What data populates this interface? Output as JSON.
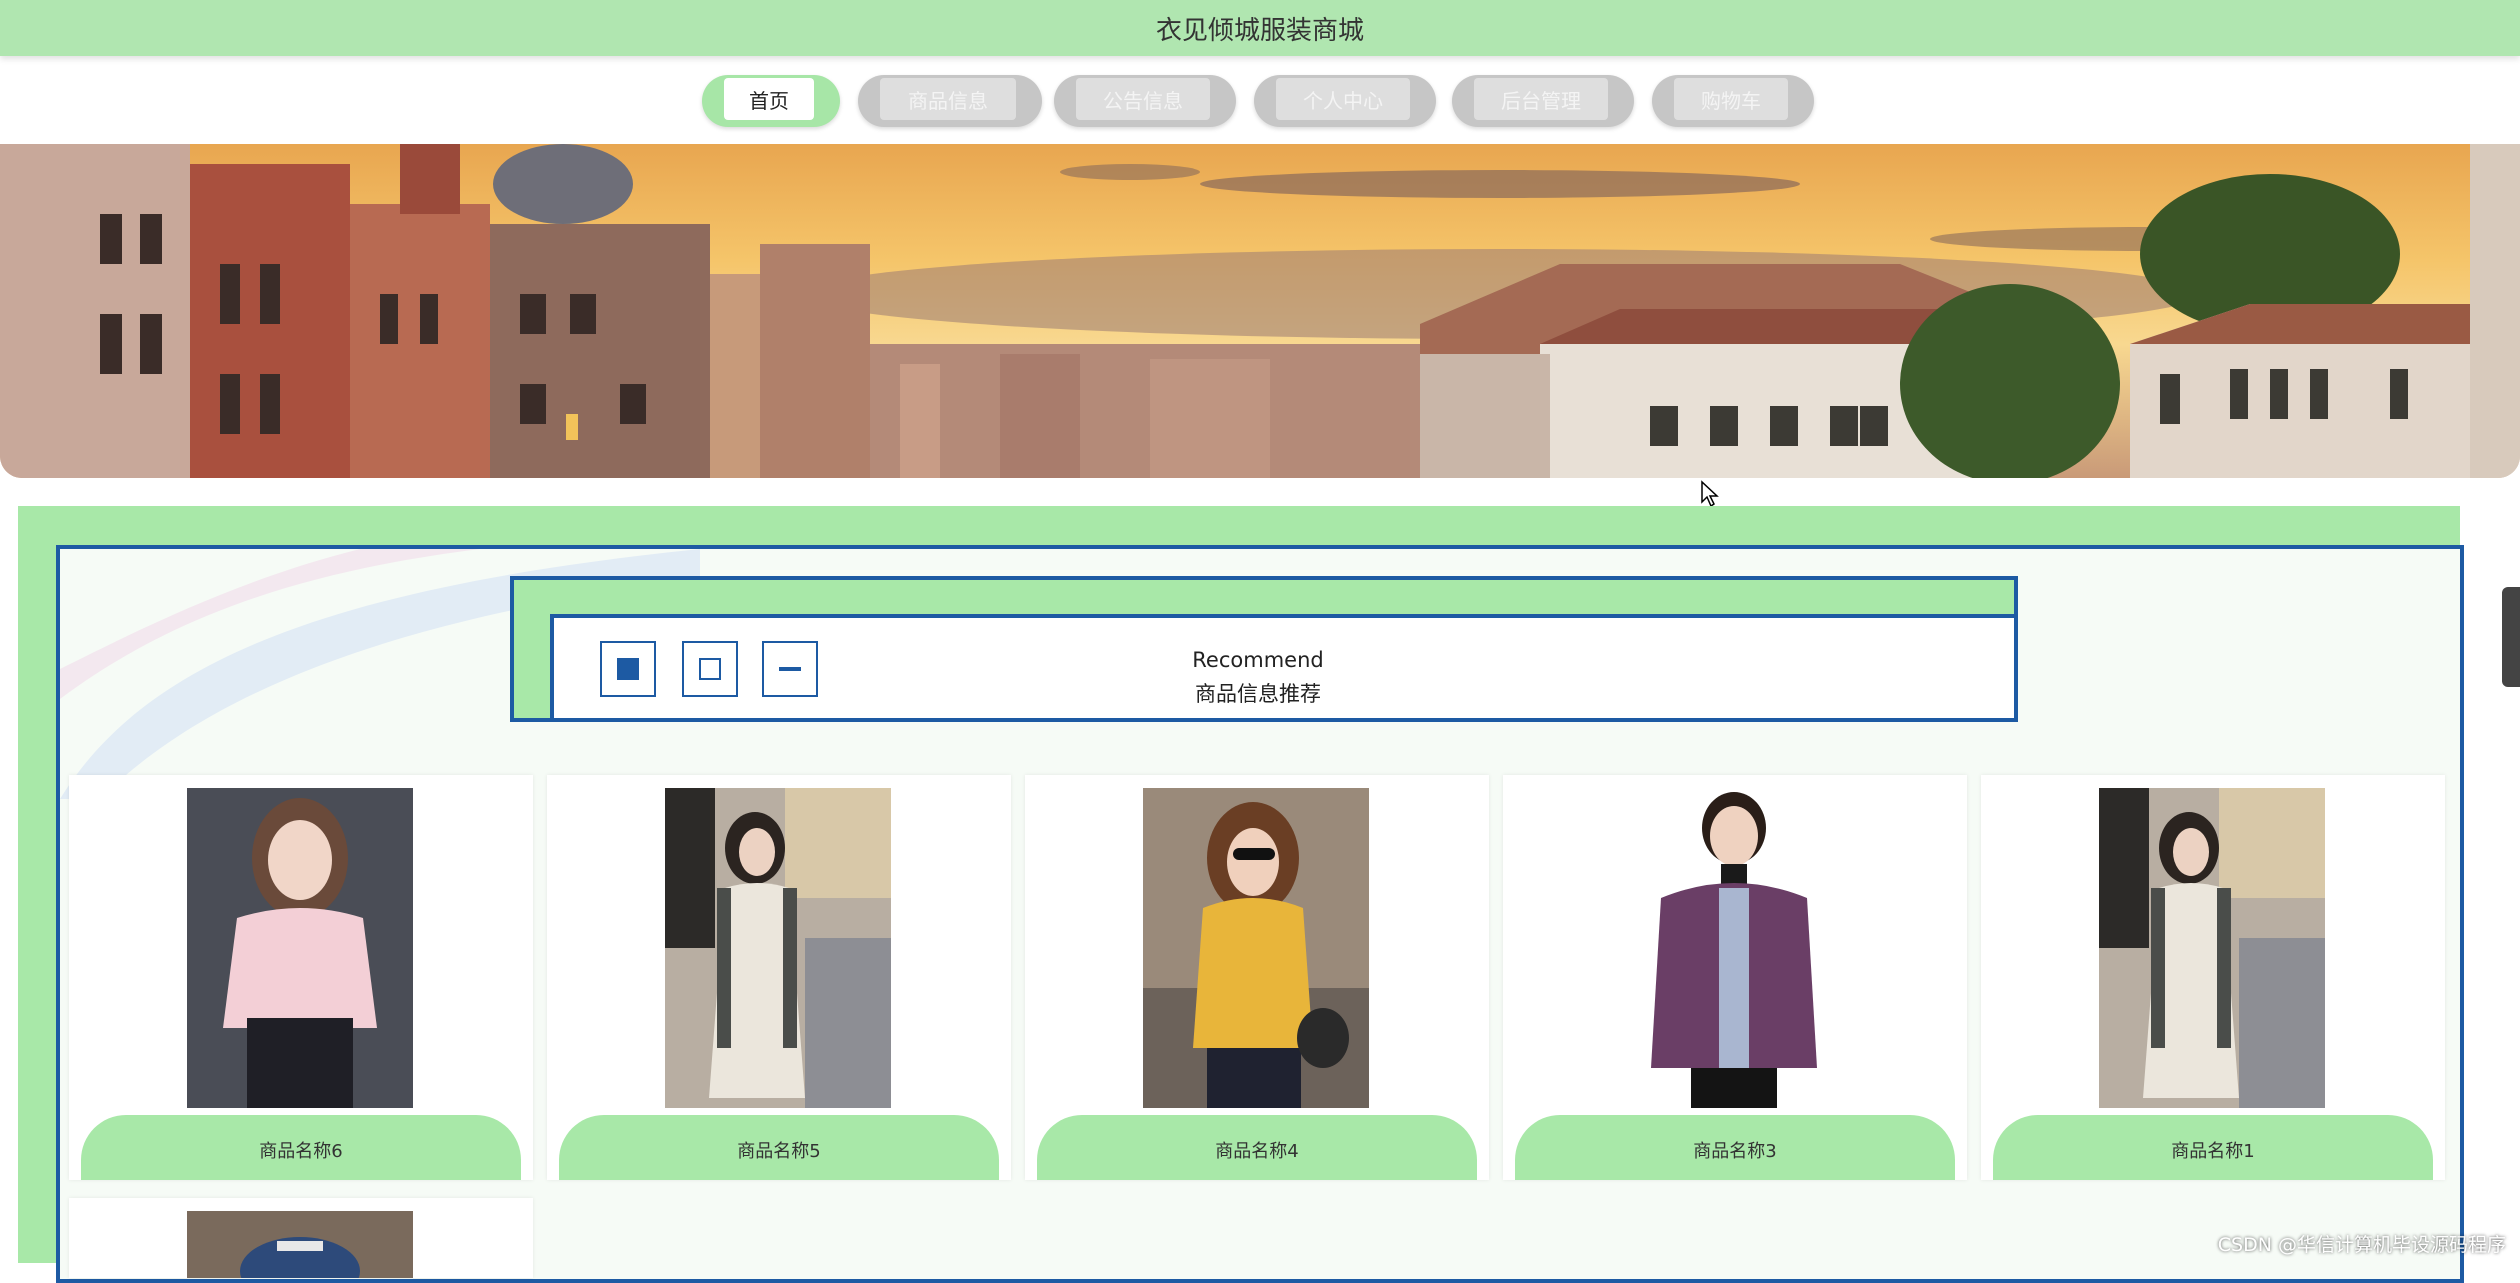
{
  "site": {
    "title": "衣见倾城服装商城"
  },
  "nav": {
    "items": [
      {
        "label": "首页",
        "active": true
      },
      {
        "label": "商品信息",
        "active": false
      },
      {
        "label": "公告信息",
        "active": false
      },
      {
        "label": "个人中心",
        "active": false
      },
      {
        "label": "后台管理",
        "active": false
      },
      {
        "label": "购物车",
        "active": false
      }
    ]
  },
  "banner": {
    "image": "venice-sunset-cityscape"
  },
  "recommend": {
    "title_en": "Recommend",
    "title_cn": "商品信息推荐",
    "controls": [
      "filled-square-icon",
      "empty-square-icon",
      "minus-icon"
    ]
  },
  "products": [
    {
      "name": "商品名称6",
      "image": "woman-pink-shirt"
    },
    {
      "name": "商品名称5",
      "image": "woman-white-dress"
    },
    {
      "name": "商品名称4",
      "image": "woman-yellow-sweater"
    },
    {
      "name": "商品名称3",
      "image": "man-purple-jacket"
    },
    {
      "name": "商品名称1",
      "image": "woman-white-dress"
    }
  ],
  "extra_product": {
    "image": "person-blue-cap"
  },
  "watermark": "CSDN @华信计算机毕设源码程序",
  "colors": {
    "accent_green": "#a8e8a8",
    "border_blue": "#1d5aa3",
    "topbar": "#b0e6b0"
  }
}
